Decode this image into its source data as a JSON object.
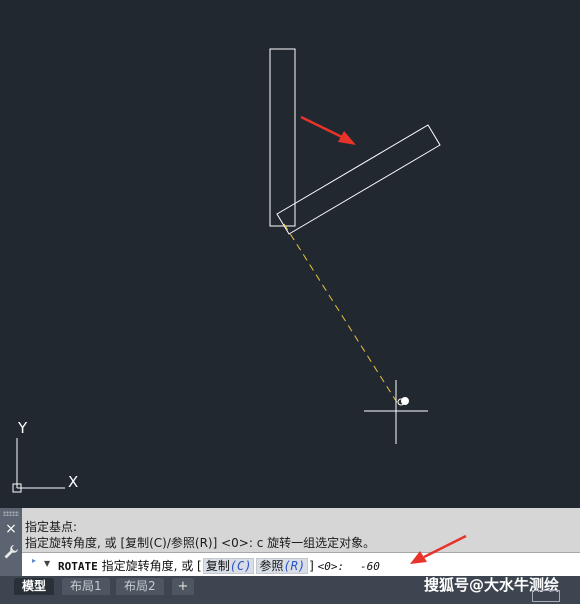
{
  "canvas": {
    "background": "#212830",
    "ucs_icon": {
      "x_label": "X",
      "y_label": "Y"
    },
    "original_rect_color": "#ffffff",
    "rotated_rect_color": "#ffffff",
    "rubber_band_color": "#e8c040",
    "arrow_color": "#e8332a"
  },
  "command": {
    "history": [
      "指定基点:",
      "指定旋转角度, 或 [复制(C)/参照(R)] <0>:  c 旋转一组选定对象。"
    ],
    "current": {
      "command_name": "ROTATE",
      "prompt": "指定旋转角度, 或",
      "bracket_open": "[",
      "option_copy_label": "复制",
      "option_copy_key": "(C)",
      "option_ref_label": "参照",
      "option_ref_key": "(R)",
      "bracket_close": "]",
      "default": "<0>:",
      "input": "-60"
    }
  },
  "side_panel": {
    "close_glyph": "×"
  },
  "layout_tabs": [
    {
      "label": "模型",
      "active": true
    },
    {
      "label": "布局1",
      "active": false
    },
    {
      "label": "布局2",
      "active": false
    }
  ],
  "add_tab_label": "+",
  "watermark": "搜狐号@大水牛测绘"
}
